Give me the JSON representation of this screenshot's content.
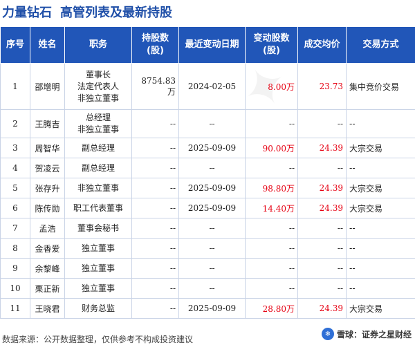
{
  "header": {
    "stock_name": "力量钻石",
    "subtitle": "高管列表及最新持股"
  },
  "table": {
    "columns": [
      "序号",
      "姓名",
      "职务",
      "持股数\n(股)",
      "最近变动日期",
      "变动股数\n(股)",
      "成交均价",
      "交易方式"
    ],
    "rows": [
      {
        "no": "1",
        "name": "邵增明",
        "position": "董事长\n法定代表人\n非独立董事",
        "shares": "8754.83万",
        "date": "2024-02-05",
        "change": "8.00万",
        "price": "23.73",
        "method": "集中竞价交易"
      },
      {
        "no": "2",
        "name": "王腾吉",
        "position": "总经理\n非独立董事",
        "shares": "--",
        "date": "--",
        "change": "--",
        "price": "--",
        "method": "--"
      },
      {
        "no": "3",
        "name": "周智华",
        "position": "副总经理",
        "shares": "--",
        "date": "2025-09-09",
        "change": "90.00万",
        "price": "24.39",
        "method": "大宗交易"
      },
      {
        "no": "4",
        "name": "贺凌云",
        "position": "副总经理",
        "shares": "--",
        "date": "--",
        "change": "--",
        "price": "--",
        "method": "--"
      },
      {
        "no": "5",
        "name": "张存升",
        "position": "非独立董事",
        "shares": "--",
        "date": "2025-09-09",
        "change": "98.80万",
        "price": "24.39",
        "method": "大宗交易"
      },
      {
        "no": "6",
        "name": "陈传勋",
        "position": "职工代表董事",
        "shares": "--",
        "date": "2025-09-09",
        "change": "14.40万",
        "price": "24.39",
        "method": "大宗交易"
      },
      {
        "no": "7",
        "name": "孟浩",
        "position": "董事会秘书",
        "shares": "--",
        "date": "--",
        "change": "--",
        "price": "--",
        "method": "--"
      },
      {
        "no": "8",
        "name": "金香爱",
        "position": "独立董事",
        "shares": "--",
        "date": "--",
        "change": "--",
        "price": "--",
        "method": "--"
      },
      {
        "no": "9",
        "name": "余黎峰",
        "position": "独立董事",
        "shares": "--",
        "date": "--",
        "change": "--",
        "price": "--",
        "method": "--"
      },
      {
        "no": "10",
        "name": "栗正新",
        "position": "独立董事",
        "shares": "--",
        "date": "--",
        "change": "--",
        "price": "--",
        "method": "--"
      },
      {
        "no": "11",
        "name": "王晓君",
        "position": "财务总监",
        "shares": "--",
        "date": "2025-09-09",
        "change": "28.80万",
        "price": "24.39",
        "method": "大宗交易"
      }
    ]
  },
  "footer": {
    "source": "数据来源：公开数据整理，仅供参考不构成投资建议",
    "brand_logo": "雪球",
    "brand_text": "雪球：证券之星财经"
  },
  "colors": {
    "header_bg": "#2156b8",
    "title": "#1f4fa8",
    "positive": "#e60012"
  }
}
